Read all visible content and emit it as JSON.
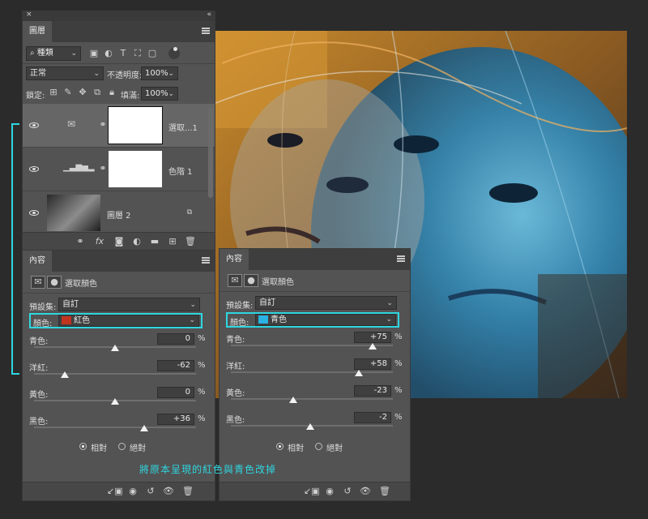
{
  "layers_panel": {
    "tab": "圖層",
    "filter_kind": "種類",
    "blend_mode": "正常",
    "opacity_label": "不透明度:",
    "opacity_value": "100%",
    "lock_label": "鎖定:",
    "fill_label": "填滿:",
    "fill_value": "100%",
    "layers": [
      {
        "name": "選取...1"
      },
      {
        "name": "色階 1"
      },
      {
        "name": "圖層 2"
      }
    ]
  },
  "props_left": {
    "tab": "內容",
    "title": "選取顏色",
    "preset_label": "預設集:",
    "preset_value": "自訂",
    "color_label": "顏色:",
    "color_value": "紅色",
    "color_swatch": "#c0341f",
    "sliders": [
      {
        "label": "青色:",
        "value": "0",
        "unit": "%",
        "norm": 0.5
      },
      {
        "label": "洋紅:",
        "value": "-62",
        "unit": "%",
        "norm": 0.19
      },
      {
        "label": "黃色:",
        "value": "0",
        "unit": "%",
        "norm": 0.5
      },
      {
        "label": "黑色:",
        "value": "+36",
        "unit": "%",
        "norm": 0.68
      }
    ],
    "radio_relative": "相對",
    "radio_absolute": "絕對"
  },
  "props_right": {
    "tab": "內容",
    "title": "選取顏色",
    "preset_label": "預設集:",
    "preset_value": "自訂",
    "color_label": "顏色:",
    "color_value": "青色",
    "color_swatch": "#2ab2e3",
    "sliders": [
      {
        "label": "青色:",
        "value": "+75",
        "unit": "%",
        "norm": 0.875
      },
      {
        "label": "洋紅:",
        "value": "+58",
        "unit": "%",
        "norm": 0.79
      },
      {
        "label": "黃色:",
        "value": "-23",
        "unit": "%",
        "norm": 0.385
      },
      {
        "label": "黑色:",
        "value": "-2",
        "unit": "%",
        "norm": 0.49
      }
    ],
    "radio_relative": "相對",
    "radio_absolute": "絕對"
  },
  "annotation": "將原本呈現的紅色與青色改掉",
  "colors": {
    "accent_cyan": "#2fd6e0",
    "panel": "#535353"
  }
}
